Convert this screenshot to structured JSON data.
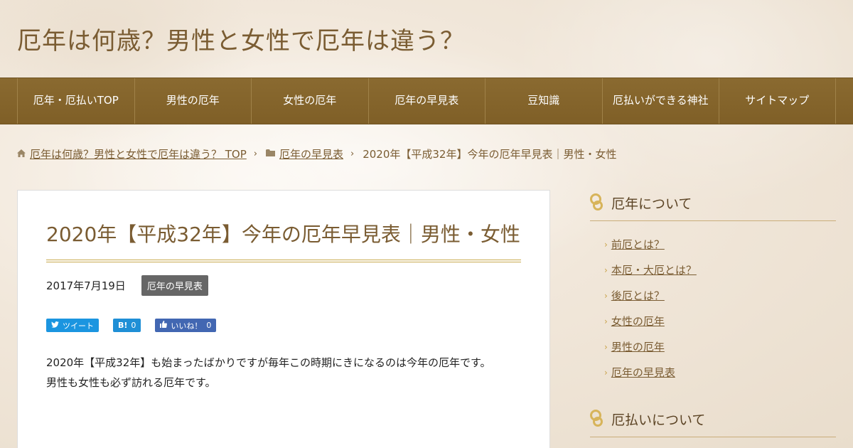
{
  "site": {
    "title": "厄年は何歳？男性と女性で厄年は違う？"
  },
  "nav": [
    {
      "label": "厄年・厄払いTOP"
    },
    {
      "label": "男性の厄年"
    },
    {
      "label": "女性の厄年"
    },
    {
      "label": "厄年の早見表"
    },
    {
      "label": "豆知識"
    },
    {
      "label": "厄払いができる神社"
    },
    {
      "label": "サイトマップ"
    }
  ],
  "breadcrumb": {
    "home": "厄年は何歳？男性と女性で厄年は違う？ TOP",
    "category": "厄年の早見表",
    "current": "2020年【平成32年】今年の厄年早見表｜男性・女性",
    "home_icon": "home-icon",
    "folder_icon": "folder-icon"
  },
  "article": {
    "title": "2020年【平成32年】今年の厄年早見表｜男性・女性",
    "date": "2017年7月19日",
    "category": "厄年の早見表",
    "share": {
      "tweet": "ツイート",
      "hatena_count": "0",
      "like": "いいね！",
      "like_count": "0"
    },
    "body_line1": "2020年【平成32年】も始まったばかりですが毎年この時期にきになるのは今年の厄年です。",
    "body_line2": "男性も女性も必ず訪れる厄年です。"
  },
  "sidebar": {
    "heading1": "厄年について",
    "links": [
      {
        "label": "前厄とは？"
      },
      {
        "label": "本厄・大厄とは？"
      },
      {
        "label": "後厄とは？"
      },
      {
        "label": "女性の厄年"
      },
      {
        "label": "男性の厄年"
      },
      {
        "label": "厄年の早見表"
      }
    ],
    "heading2": "厄払いについて"
  },
  "colors": {
    "nav_bg": "#8a6a30",
    "accent": "#7a5c32",
    "gold": "#c7a84a"
  }
}
